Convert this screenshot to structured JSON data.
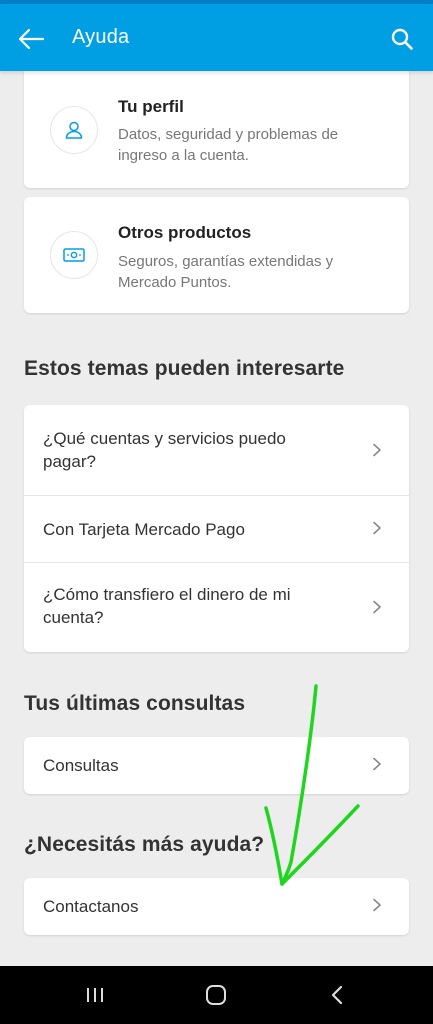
{
  "header": {
    "title": "Ayuda",
    "back_icon": "arrow-left-icon",
    "search_icon": "search-icon",
    "color": "#009ee3"
  },
  "cards": [
    {
      "title": "Tu perfil",
      "description": "Datos, seguridad y problemas de ingreso a la cuenta.",
      "icon": "user-icon"
    },
    {
      "title": "Otros productos",
      "description": "Seguros, garantías extendidas y Mercado Puntos.",
      "icon": "ticket-icon"
    }
  ],
  "topics": {
    "title": "Estos temas pueden interesarte",
    "items": [
      "¿Qué cuentas y servicios puedo pagar?",
      "Con Tarjeta Mercado Pago",
      "¿Cómo transfiero el dinero de mi cuenta?"
    ]
  },
  "recent": {
    "title": "Tus últimas consultas",
    "items": [
      "Consultas"
    ]
  },
  "help": {
    "title": "¿Necesitás más ayuda?",
    "items": [
      "Contactanos"
    ]
  },
  "annotation": {
    "icon": "hand-drawn-arrow-icon",
    "color": "#1fd61f"
  },
  "navbar": {
    "recent_apps_icon": "recent-apps-icon",
    "home_icon": "home-icon",
    "back_icon": "back-nav-icon"
  }
}
